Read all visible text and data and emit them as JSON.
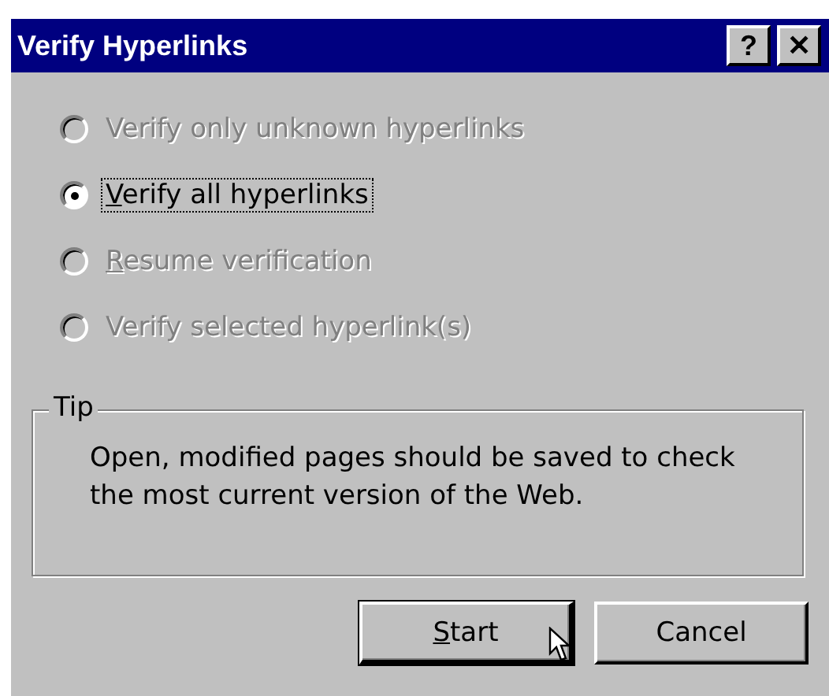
{
  "window": {
    "title": "Verify Hyperlinks",
    "title_buttons": [
      {
        "label": "?"
      },
      {
        "label": "✕"
      }
    ]
  },
  "options": [
    {
      "label": "Verify only unknown hyperlinks",
      "selected": false,
      "disabled": true,
      "focused": false
    },
    {
      "mnemonic": "V",
      "label_after": "erify all hyperlinks",
      "selected": true,
      "disabled": false,
      "focused": true
    },
    {
      "mnemonic": "R",
      "label_after": "esume verification",
      "selected": false,
      "disabled": true,
      "focused": false
    },
    {
      "label": "Verify selected hyperlink(s)",
      "selected": false,
      "disabled": true,
      "focused": false
    }
  ],
  "tip": {
    "title": "Tip",
    "text": "Open, modified pages should be saved to check the most current version of the Web."
  },
  "buttons": [
    {
      "mnemonic": "S",
      "label_after": "tart",
      "default": true,
      "hovered": true
    },
    {
      "label": "Cancel",
      "default": false,
      "hovered": false
    }
  ]
}
